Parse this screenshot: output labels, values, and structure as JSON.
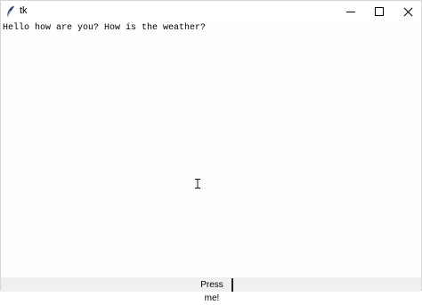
{
  "window": {
    "title": "tk"
  },
  "titlebar": {
    "app_icon": "feather-icon",
    "controls": [
      "minimize-icon",
      "maximize-icon",
      "close-icon"
    ]
  },
  "text_widget": {
    "content": "Hello how are you? How is the weather?"
  },
  "bottom": {
    "button_label": "Press me!"
  },
  "colors": {
    "titlebar_bg": "#ffffff",
    "text_bg": "#fdfdfd",
    "bottom_bg": "#f0f0f0"
  }
}
